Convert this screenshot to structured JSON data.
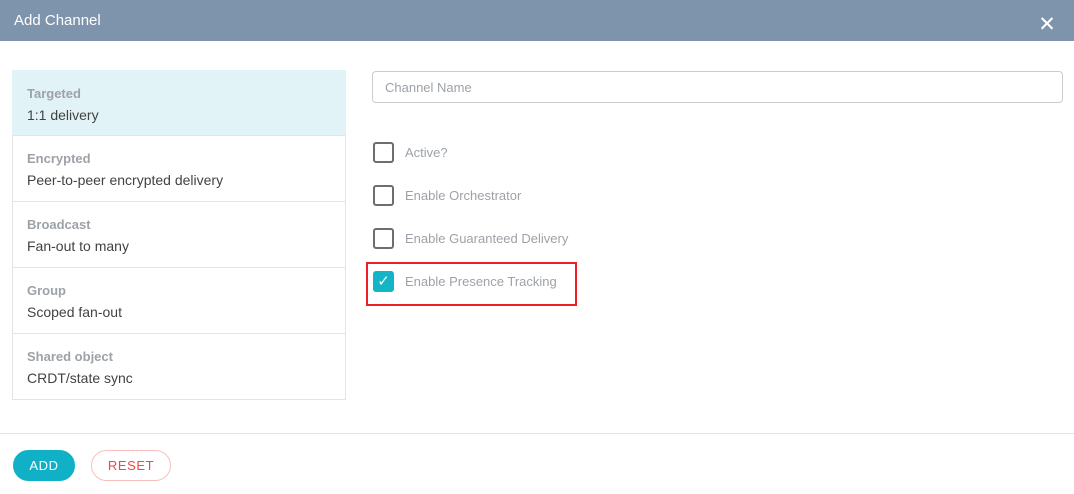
{
  "dialog": {
    "title": "Add Channel"
  },
  "icons": {
    "close": "✕",
    "check": "✓"
  },
  "colors": {
    "header_bg": "#7e93ac",
    "accent_teal": "#12b4c6",
    "selected_item_bg": "#e1f3f7",
    "highlight_red": "#ed1f24",
    "reset_text_red": "#f4453f",
    "reset_border": "#f8c0bc"
  },
  "channel_types": [
    {
      "title": "Targeted",
      "subtitle": "1:1 delivery",
      "selected": true
    },
    {
      "title": "Encrypted",
      "subtitle": "Peer-to-peer encrypted delivery",
      "selected": false
    },
    {
      "title": "Broadcast",
      "subtitle": "Fan-out to many",
      "selected": false
    },
    {
      "title": "Group",
      "subtitle": "Scoped fan-out",
      "selected": false
    },
    {
      "title": "Shared object",
      "subtitle": "CRDT/state sync",
      "selected": false
    }
  ],
  "form": {
    "channel_name": {
      "value": "",
      "placeholder": "Channel Name"
    },
    "checkboxes": [
      {
        "label": "Active?",
        "checked": false,
        "highlighted": false
      },
      {
        "label": "Enable Orchestrator",
        "checked": false,
        "highlighted": false
      },
      {
        "label": "Enable Guaranteed Delivery",
        "checked": false,
        "highlighted": false
      },
      {
        "label": "Enable Presence Tracking",
        "checked": true,
        "highlighted": true
      }
    ]
  },
  "footer": {
    "add_label": "ADD",
    "reset_label": "RESET"
  }
}
